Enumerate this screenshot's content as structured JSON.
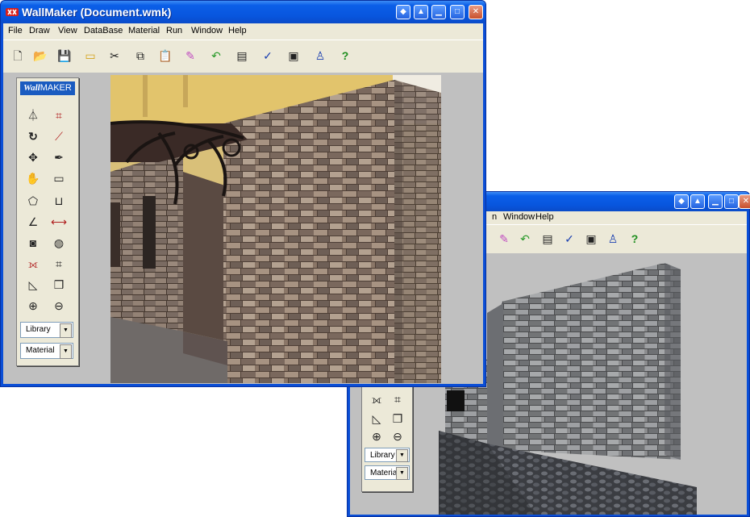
{
  "window1": {
    "title": "WallMaker (Document.wmk)",
    "menu": [
      "File",
      "Draw",
      "View",
      "DataBase",
      "Material",
      "Run",
      "Window",
      "Help"
    ],
    "toolbar": [
      "new-icon",
      "open-icon",
      "save-icon",
      "folder-icon",
      "cut-icon",
      "copy-icon",
      "paste-icon",
      "eraser-icon",
      "undo-icon",
      "properties-icon",
      "check-icon",
      "settings-icon",
      "render-icon",
      "help-icon"
    ],
    "palette": {
      "logo_bold": "Wall",
      "logo_rest": "MAKER",
      "library": "Library",
      "material": "Material"
    }
  },
  "window2": {
    "menu": [
      "n",
      "Window",
      "Help"
    ],
    "palette": {
      "library": "Library",
      "material": "Material"
    }
  },
  "colors": {
    "titlebar": "#0855dd",
    "chrome": "#ece9d8",
    "client": "#c0c0c0",
    "stone_warm": "#8a7667",
    "stone_grey": "#8b8c8e"
  }
}
